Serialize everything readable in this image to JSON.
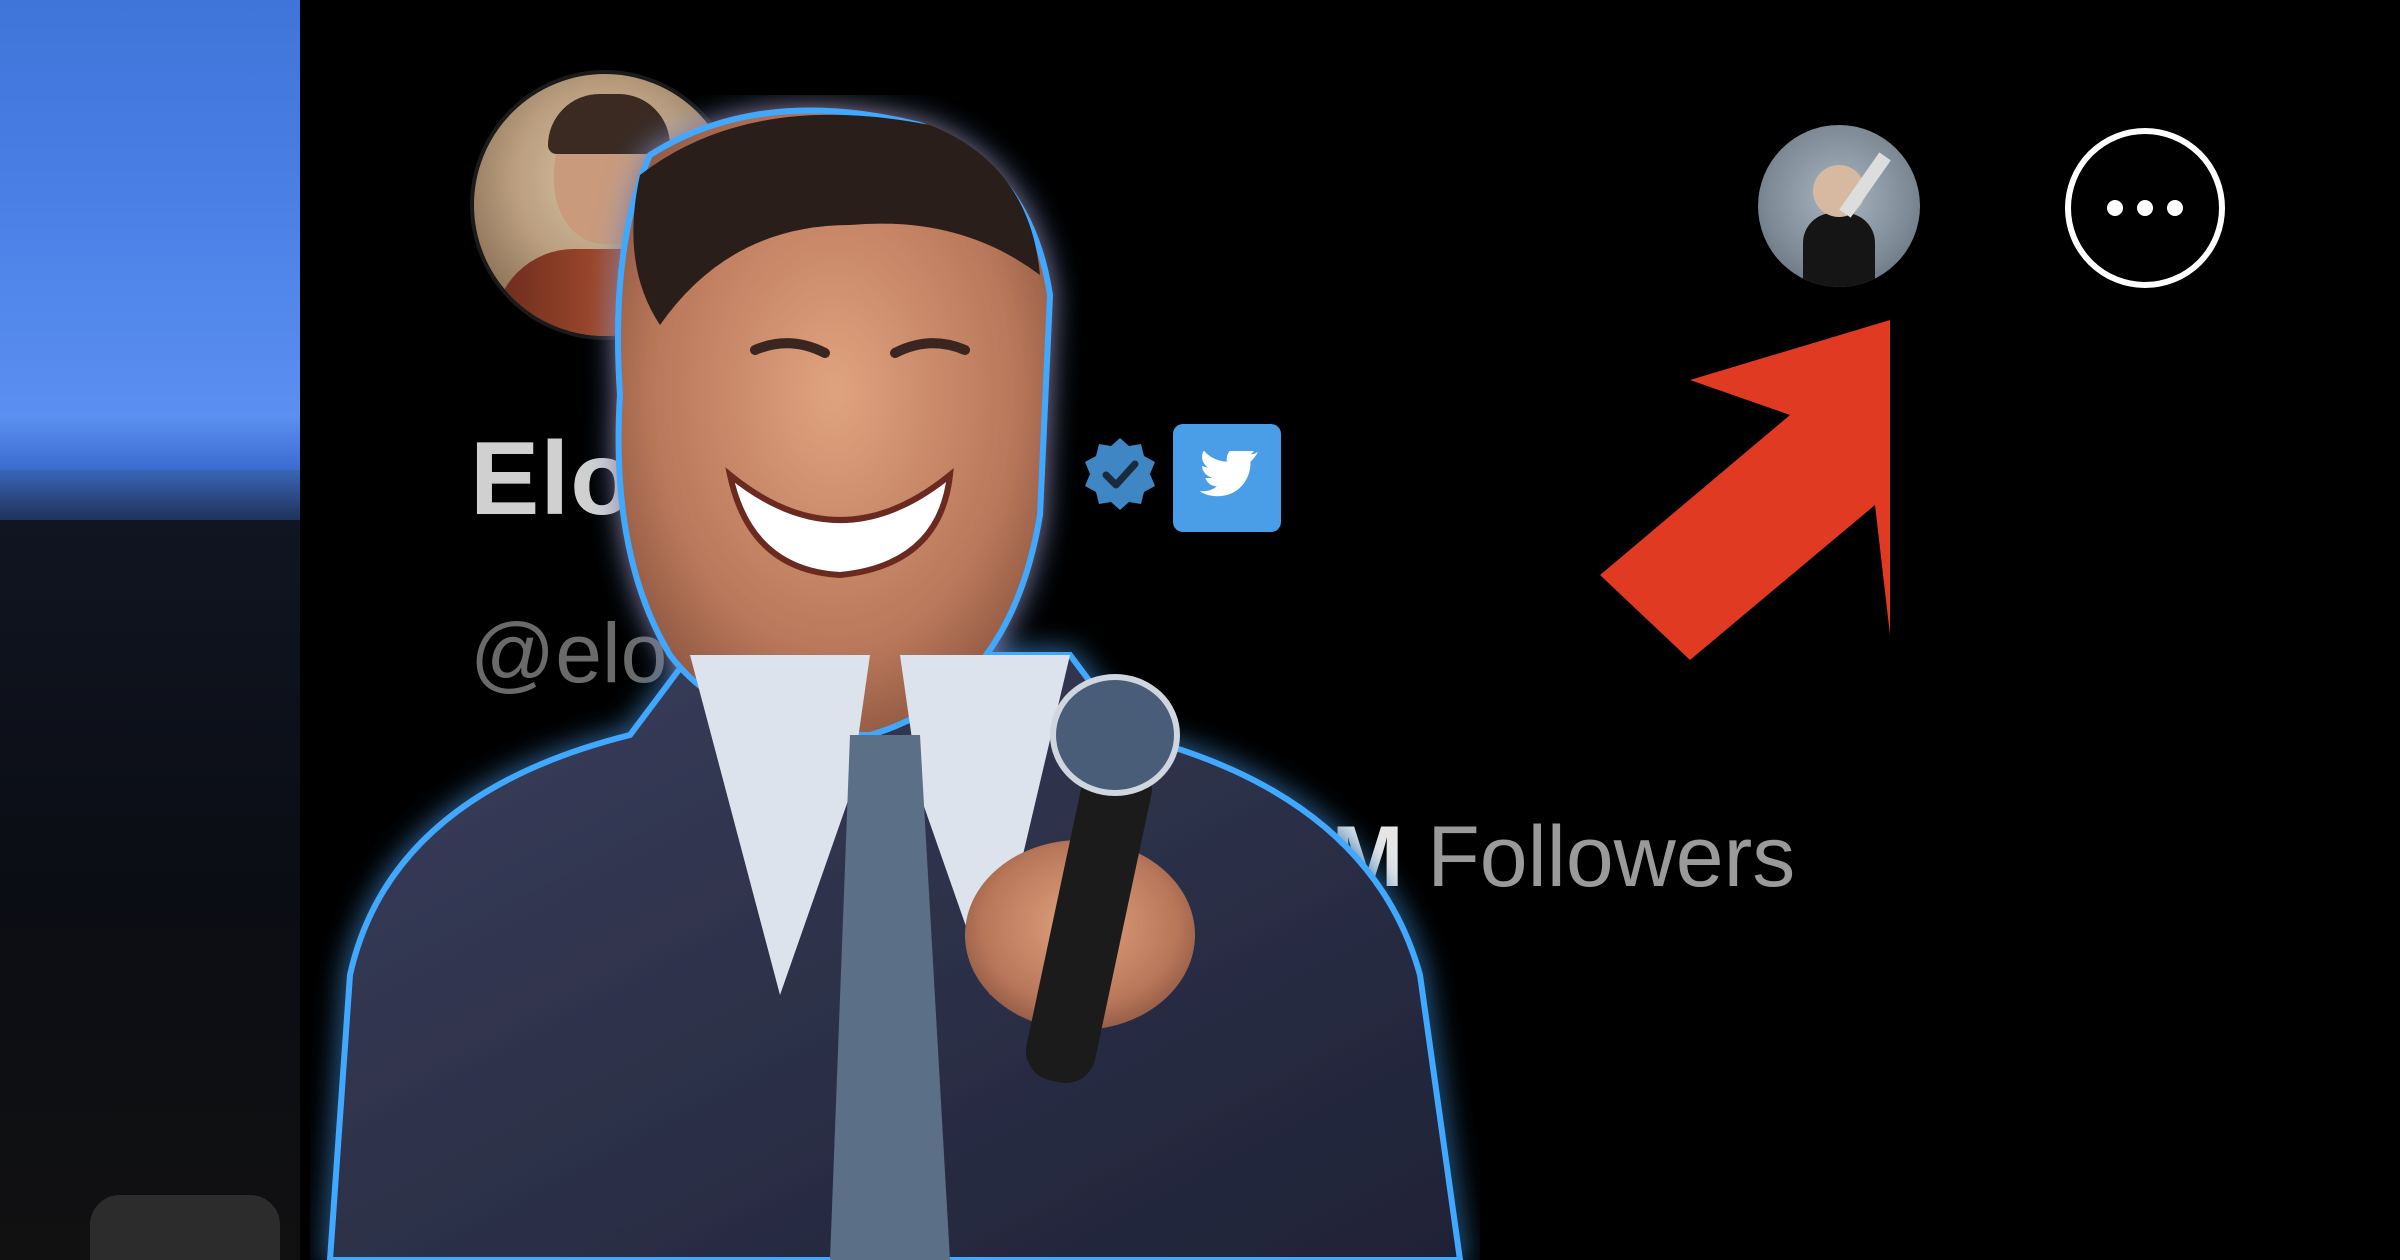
{
  "profile": {
    "display_name": "Elon",
    "handle": "@elo",
    "followers_count": ".4M",
    "followers_label": " Followers"
  },
  "icons": {
    "verified": "verified-badge-icon",
    "twitter": "twitter-bird-icon",
    "more": "more-options-icon",
    "arrow": "red-arrow-icon"
  },
  "colors": {
    "background": "#000000",
    "twitter_blue": "#4a9ee8",
    "arrow_red": "#e03a22",
    "name_text": "#d0d0d0",
    "handle_text": "#6a6a6a",
    "glow": "#3fa9ff"
  }
}
